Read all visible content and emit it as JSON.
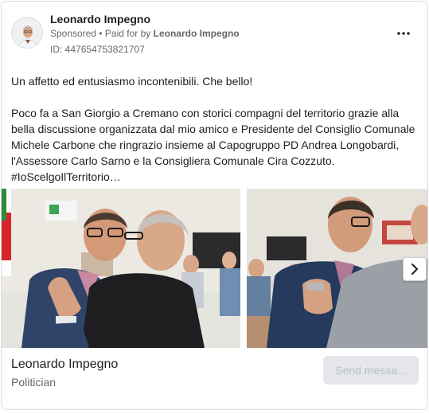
{
  "ad": {
    "page_name": "Leonardo Impegno",
    "sponsored_label": "Sponsored",
    "paid_for_prefix": " • Paid for by ",
    "paid_for_name": "Leonardo Impegno",
    "ad_id": "ID: 447654753821707",
    "more_icon": "more-horizontal-icon",
    "body_text": "Un affetto ed entusiasmo incontenibili. Che bello!\n\nPoco fa a San Giorgio a Cremano con storici compagni del territorio grazie alla bella discussione organizzata dal mio amico e Presidente del Consiglio Comunale Michele Carbone che ringrazio insieme al Capogruppo PD Andrea Longobardi, l'Assessore Carlo Sarno e la Consigliera Comunale Cira Cozzuto.\n#IoScelgoIlTerritorio…"
  },
  "carousel": {
    "next_icon": "chevron-right-icon"
  },
  "footer": {
    "page_name": "Leonardo Impegno",
    "category": "Politician",
    "cta_label": "Send messa..."
  },
  "colors": {
    "text_primary": "#1c1e21",
    "text_secondary": "#65676b",
    "border": "#dadde1",
    "cta_bg": "#e4e6eb",
    "cta_text": "#bcc0c4"
  }
}
